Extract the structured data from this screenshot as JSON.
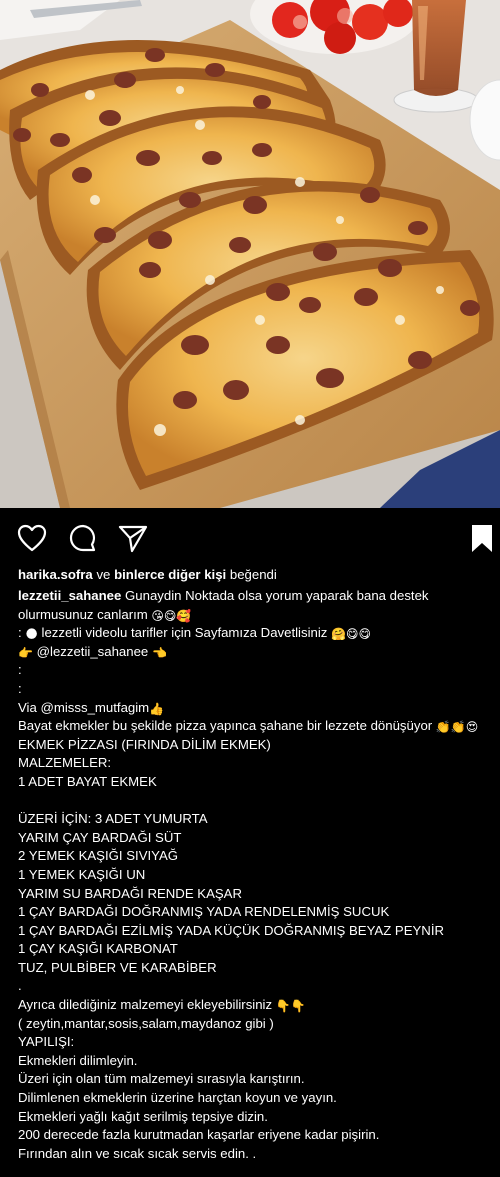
{
  "post": {
    "photo_alt": "bread pizza slices with sucuk and cheese on a wooden board",
    "likes": {
      "user": "harika.sofra",
      "joiner": "ve",
      "others": "binlerce diğer kişi",
      "suffix": "beğendi"
    },
    "caption": {
      "username": "lezzetii_sahanee",
      "first_line_text": "Gunaydin Noktada olsa yorum yaparak bana destek",
      "second_line_text": "olurmusunuz canlarım",
      "second_line_emoji": "😘😋🥰",
      "invite_prefix": ":",
      "invite_emoji_lead": "🌑",
      "invite_text": "lezzetli videolu tarifler için Sayfamıza Davetlisiniz",
      "invite_emoji_tail": "🤗😋😋",
      "mention_lead_emoji": "👉",
      "mention": "@lezzetii_sahanee",
      "mention_tail_emoji": "👈",
      "dots": [
        ":",
        ":"
      ],
      "via_prefix": "Via",
      "via_mention": "@misss_mutfagim",
      "via_emoji": "👍",
      "lines": [
        "Bayat ekmekler bu şekilde pizza yapınca şahane bir lezzete dönüşüyor",
        "EKMEK PİZZASI (FIRINDA DİLİM EKMEK)",
        "MALZEMELER:",
        "1 ADET BAYAT EKMEK",
        "",
        "ÜZERİ İÇİN: 3 ADET YUMURTA",
        "YARIM ÇAY BARDAĞI SÜT",
        "2 YEMEK KAŞIĞI SIVIYAĞ",
        "1 YEMEK KAŞIĞI UN",
        "YARIM SU BARDAĞI RENDE KAŞAR",
        "1 ÇAY BARDAĞI DOĞRANMIŞ YADA RENDELENMİŞ SUCUK",
        "1 ÇAY BARDAĞI EZİLMİŞ YADA KÜÇÜK DOĞRANMIŞ BEYAZ PEYNİR",
        "1 ÇAY KAŞIĞI KARBONAT",
        "TUZ, PULBİBER VE KARABİBER",
        ".",
        "Ayrıca dilediğiniz malzemeyi ekleyebilirsiniz",
        "( zeytin,mantar,sosis,salam,maydanoz gibi )",
        "YAPILIŞI:",
        "Ekmekleri dilimleyin.",
        "Üzeri için olan tüm malzemeyi sırasıyla karıştırın.",
        "Dilimlenen ekmeklerin üzerine harçtan koyun ve yayın.",
        "Ekmekleri yağlı kağıt serilmiş tepsiye dizin.",
        "200 derecede fazla kurutmadan kaşarlar eriyene kadar pişirin.",
        "Fırından alın ve sıcak sıcak servis edin. ."
      ],
      "first_line_emoji": "👏👏😍",
      "extra_line_emoji": "👇👇"
    }
  },
  "icons": {
    "like": "heart-icon",
    "comment": "comment-bubble-icon",
    "share": "paper-plane-icon",
    "save": "bookmark-icon"
  },
  "colors": {
    "background": "#000000",
    "text": "#ffffff",
    "board": "#c99a5e",
    "cheese": "#f0b34c",
    "sucuk": "#7a3424"
  }
}
